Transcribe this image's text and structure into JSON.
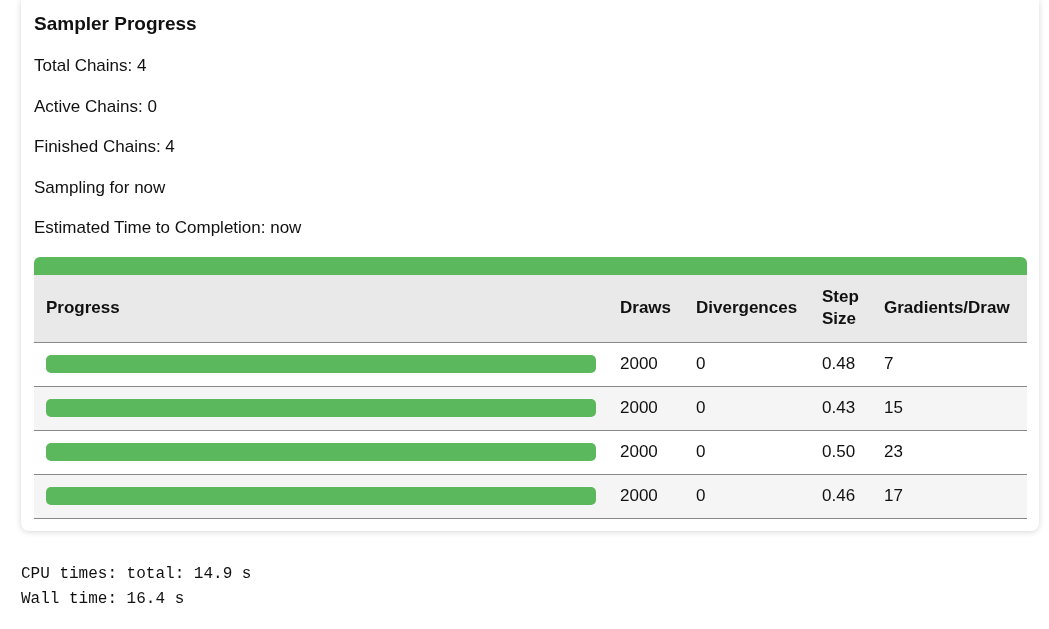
{
  "panel": {
    "title": "Sampler Progress",
    "stats": [
      "Total Chains: 4",
      "Active Chains: 0",
      "Finished Chains: 4",
      "Sampling for now",
      "Estimated Time to Completion: now"
    ],
    "overall_progress": {
      "level": 1
    }
  },
  "table": {
    "columns": [
      "Progress",
      "Draws",
      "Divergences",
      "Step Size",
      "Gradients/Draw"
    ],
    "rows": [
      {
        "progress": {
          "level": 1
        },
        "draws": "2000",
        "divergences": "0",
        "step_size": "0.48",
        "gradients_per_draw": "7"
      },
      {
        "progress": {
          "level": 1
        },
        "draws": "2000",
        "divergences": "0",
        "step_size": "0.43",
        "gradients_per_draw": "15"
      },
      {
        "progress": {
          "level": 1
        },
        "draws": "2000",
        "divergences": "0",
        "step_size": "0.50",
        "gradients_per_draw": "23"
      },
      {
        "progress": {
          "level": 1
        },
        "draws": "2000",
        "divergences": "0",
        "step_size": "0.46",
        "gradients_per_draw": "17"
      }
    ]
  },
  "output": [
    "CPU times: total: 14.9 s",
    "Wall time: 16.4 s"
  ]
}
